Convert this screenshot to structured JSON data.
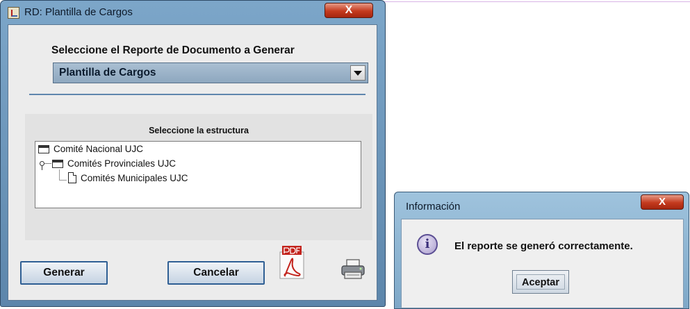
{
  "main_window": {
    "title": "RD: Plantilla de Cargos",
    "close_label": "X",
    "report_label": "Seleccione el Reporte de Documento a Generar",
    "report_select": {
      "selected": "Plantilla de Cargos"
    },
    "structure_label": "Seleccione la estructura",
    "tree": {
      "root": "Comité Nacional UJC",
      "child": "Comités Provinciales UJC",
      "grandchild": "Comités Municipales UJC"
    },
    "buttons": {
      "generate": "Generar",
      "cancel": "Cancelar"
    },
    "icons": [
      "app-icon",
      "pdf-icon",
      "printer-icon"
    ]
  },
  "info_dialog": {
    "title": "Información",
    "close_label": "X",
    "message": "El reporte se generó correctamente.",
    "ok_label": "Aceptar",
    "icon": "info-icon"
  },
  "colors": {
    "titlebar": "#7ca6c9",
    "close_button": "#c43a1e",
    "combo": "#9bb3c9",
    "separator": "#5f86ad"
  }
}
